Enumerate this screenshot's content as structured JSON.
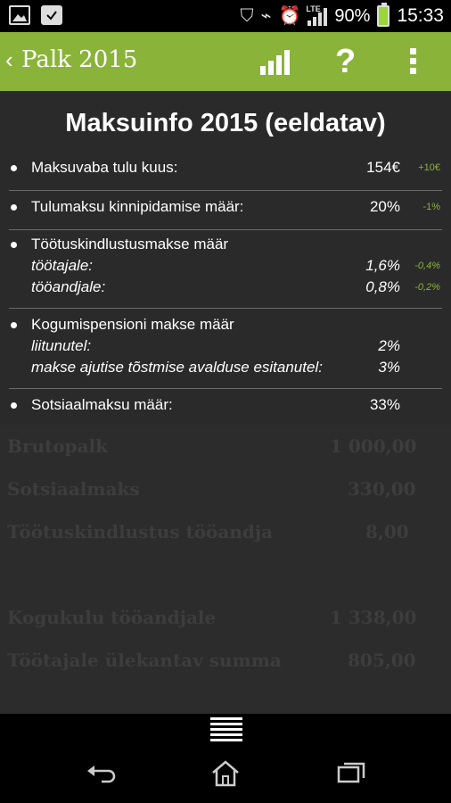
{
  "statusbar": {
    "battery_percent": "90%",
    "time": "15:33",
    "network_label": "LTE",
    "icons": [
      "image-icon",
      "briefcase-icon",
      "shield-icon",
      "vibrate-icon",
      "alarm-icon",
      "signal-icon",
      "battery-icon"
    ]
  },
  "actionbar": {
    "back_icon": "‹",
    "title": "Palk 2015",
    "help_label": "?",
    "icons": [
      "chevron-left-icon",
      "bar-chart-icon",
      "help-icon",
      "overflow-menu-icon"
    ],
    "accent_color": "#8ab33a"
  },
  "dialog": {
    "title": "Maksuinfo 2015 (eeldatav)",
    "items": [
      {
        "label": "Maksuvaba tulu kuus:",
        "value": "154€",
        "change": "+10€"
      },
      {
        "label": "Tulumaksu kinnipidamise määr:",
        "value": "20%",
        "change": "-1%"
      },
      {
        "label": "Töötuskindlustusmakse määr",
        "subs": [
          {
            "label": "töötajale:",
            "value": "1,6%",
            "change": "-0,4%"
          },
          {
            "label": "tööandjale:",
            "value": "0,8%",
            "change": "-0,2%"
          }
        ]
      },
      {
        "label": "Kogumispensioni makse määr",
        "subs": [
          {
            "label": "liitunutel:",
            "value": "2%"
          },
          {
            "label": "makse ajutise tõstmise avalduse esitanutel:",
            "value": "3%"
          }
        ]
      },
      {
        "label": "Sotsiaalmaksu määr:",
        "value": "33%"
      }
    ]
  },
  "background_rows": [
    {
      "label": "Brutopalk",
      "value": "1 000,00"
    },
    {
      "label": "Sotsiaalmaks",
      "value": "330,00"
    },
    {
      "label": "Töötuskindlustus tööandja",
      "value": "8,00"
    },
    {
      "label": "Kogukulu tööandjale",
      "value": "1 338,00"
    },
    {
      "label": "Töötajale ülekantav summa",
      "value": "805,00"
    }
  ],
  "navbar": {
    "icons": [
      "back-icon",
      "home-icon",
      "recent-apps-icon",
      "drawer-handle-icon"
    ]
  }
}
